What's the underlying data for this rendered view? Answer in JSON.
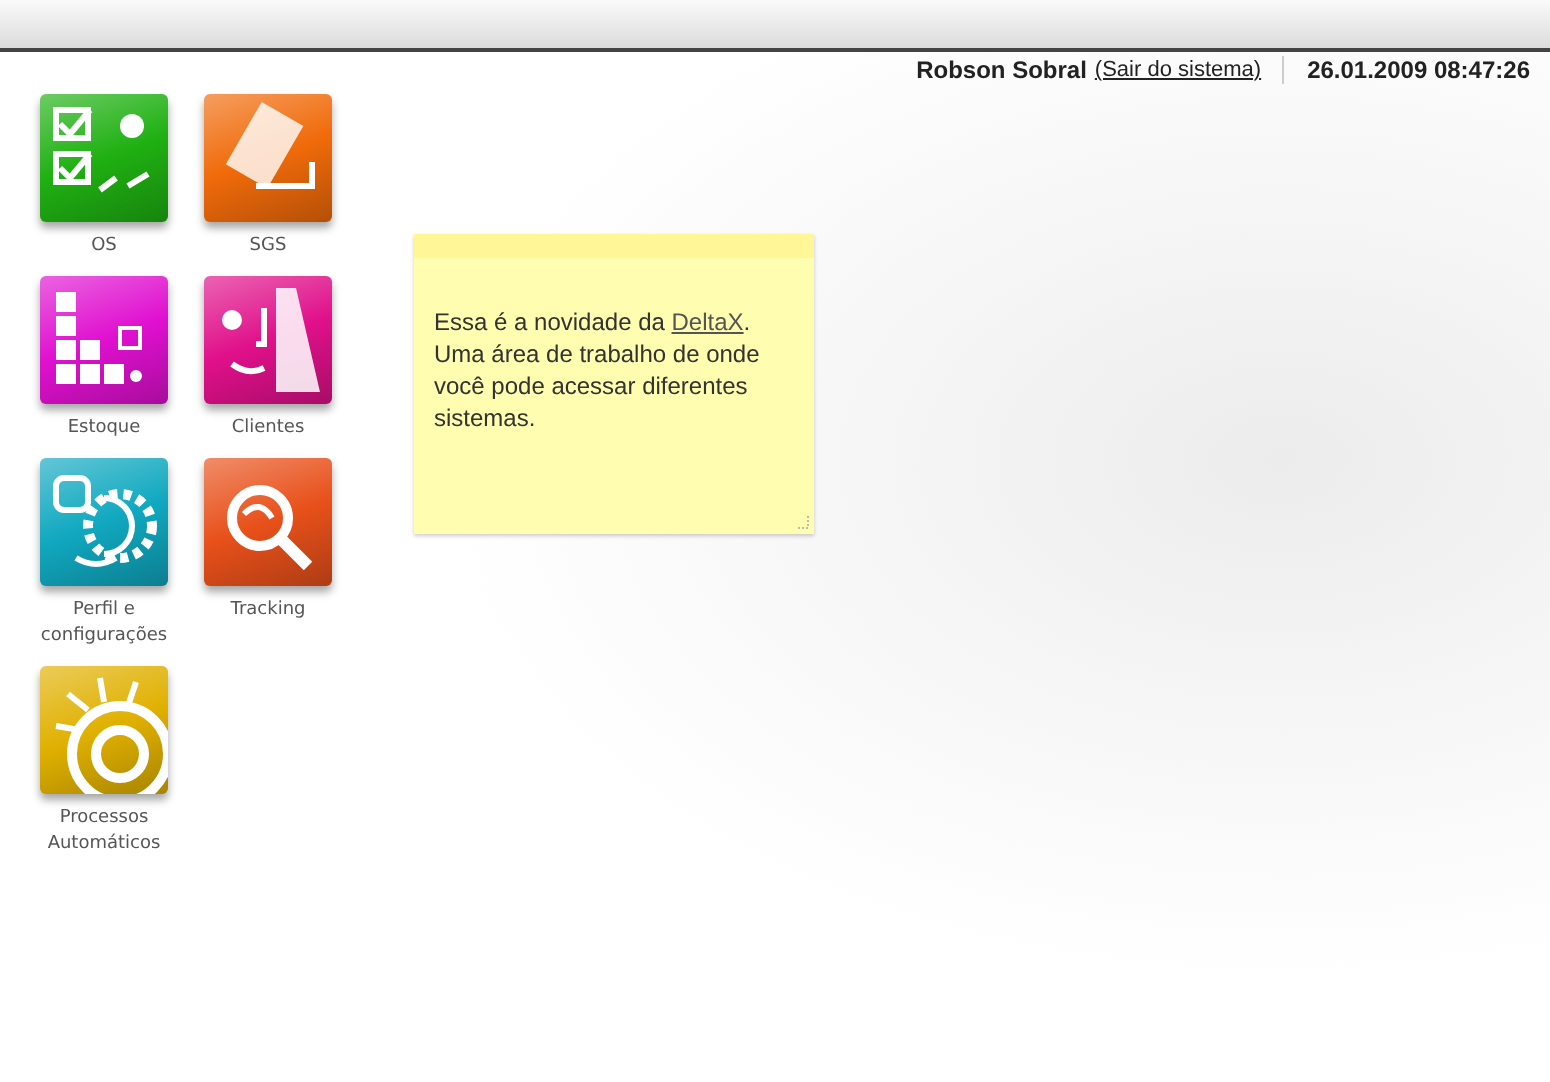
{
  "header": {
    "user": "Robson Sobral",
    "logout_link": "(Sair do sistema)",
    "datetime": "26.01.2009 08:47:26"
  },
  "apps": [
    {
      "label": "OS",
      "kind": "checklist",
      "color": "#1fb012"
    },
    {
      "label": "SGS",
      "kind": "cards",
      "color": "#f06a0a"
    },
    {
      "label": "Estoque",
      "kind": "boxes",
      "color": "#e010d0"
    },
    {
      "label": "Clientes",
      "kind": "building",
      "color": "#e0108a"
    },
    {
      "label": "Perfil e configurações",
      "kind": "gear",
      "color": "#10a8c0"
    },
    {
      "label": "Tracking",
      "kind": "magnifier",
      "color": "#e8501a"
    },
    {
      "label": "Processos Automáticos",
      "kind": "sun",
      "color": "#e0b000"
    }
  ],
  "note": {
    "text_before": "Essa é a novidade da ",
    "link": "DeltaX",
    "text_after": ". Uma área de trabalho de onde você pode acessar diferentes sistemas."
  }
}
